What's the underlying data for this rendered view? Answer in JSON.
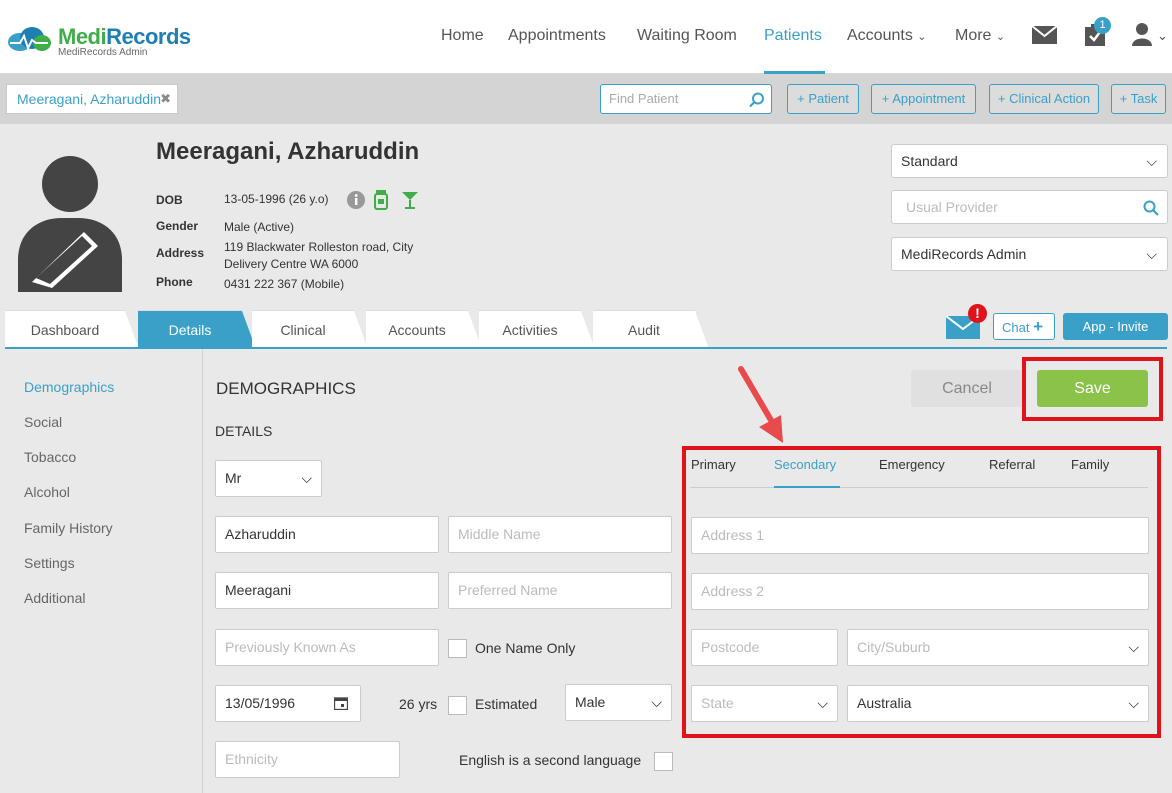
{
  "app": {
    "name_part1": "Medi",
    "name_part2": "Records",
    "subtitle": "MediRecords Admin"
  },
  "nav": {
    "home": "Home",
    "appointments": "Appointments",
    "waiting_room": "Waiting Room",
    "patients": "Patients",
    "accounts": "Accounts",
    "more": "More",
    "task_badge": "1"
  },
  "toolbar": {
    "patient_tab": "Meeragani, Azharuddin",
    "find_patient_placeholder": "Find Patient",
    "add_patient": "+ Patient",
    "add_appointment": "+ Appointment",
    "add_clinical_action": "+ Clinical Action",
    "add_task": "+ Task"
  },
  "patient": {
    "name": "Meeragani, Azharuddin",
    "dob_label": "DOB",
    "dob": "13-05-1996 (26 y.o)",
    "gender_label": "Gender",
    "gender": "Male (Active)",
    "address_label": "Address",
    "address_line1": "119 Blackwater Rolleston road, City",
    "address_line2": "Delivery Centre WA 6000",
    "phone_label": "Phone",
    "phone": "0431 222 367 (Mobile)"
  },
  "header_right": {
    "billing_type": "Standard",
    "usual_provider_placeholder": "Usual Provider",
    "practice": "MediRecords Admin"
  },
  "tabs": [
    "Dashboard",
    "Details",
    "Clinical",
    "Accounts",
    "Activities",
    "Audit"
  ],
  "tab_actions": {
    "chat": "Chat",
    "app_invite": "App - Invite",
    "alert": "!"
  },
  "sidebar": [
    "Demographics",
    "Social",
    "Tobacco",
    "Alcohol",
    "Family History",
    "Settings",
    "Additional"
  ],
  "form": {
    "section_title": "DEMOGRAPHICS",
    "details_title": "DETAILS",
    "cancel": "Cancel",
    "save": "Save",
    "title_value": "Mr",
    "first_name": "Azharuddin",
    "middle_name_placeholder": "Middle Name",
    "last_name": "Meeragani",
    "preferred_name_placeholder": "Preferred Name",
    "previously_known_placeholder": "Previously Known As",
    "one_name_only": "One Name Only",
    "dob_value": "13/05/1996",
    "age": "26 yrs",
    "estimated": "Estimated",
    "sex_value": "Male",
    "ethnicity_placeholder": "Ethnicity",
    "second_language": "English is a second language"
  },
  "address": {
    "tabs": [
      "Primary",
      "Secondary",
      "Emergency",
      "Referral",
      "Family"
    ],
    "address1_placeholder": "Address 1",
    "address2_placeholder": "Address 2",
    "postcode_placeholder": "Postcode",
    "city_placeholder": "City/Suburb",
    "state_placeholder": "State",
    "country_value": "Australia"
  },
  "colors": {
    "accent": "#3aa0c7",
    "brand_green": "#3fae49",
    "save_green": "#8bc34a",
    "annotation_red": "#e0121a"
  }
}
